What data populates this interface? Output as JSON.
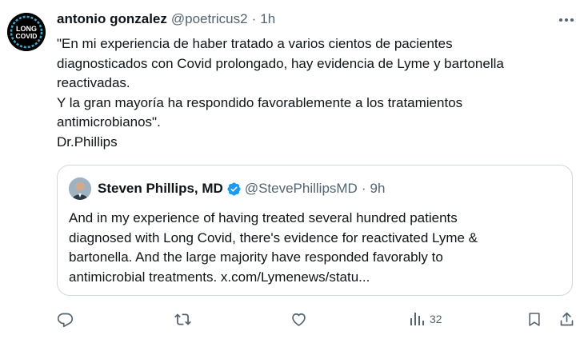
{
  "author": {
    "name": "antonio gonzalez",
    "handle": "@poetricus2",
    "separator": "·",
    "time": "1h",
    "avatar_text_top": "LONG COVID",
    "avatar_text_main_1": "LONG",
    "avatar_text_main_2": "COVID"
  },
  "tweet": {
    "lines": [
      "\"En mi experiencia de haber tratado a varios cientos de pacientes",
      "diagnosticados con Covid prolongado, hay evidencia de Lyme y bartonella",
      "reactivadas.",
      "Y la gran mayoría ha respondido favorablemente a los tratamientos",
      "antimicrobianos\".",
      "Dr.Phillips"
    ]
  },
  "quote": {
    "name": "Steven Phillips, MD",
    "handle": "@StevePhillipsMD",
    "separator": "·",
    "time": "9h",
    "lines": [
      "And in my experience of having treated several hundred patients",
      "diagnosed with Long Covid, there's evidence for reactivated Lyme &",
      "bartonella. And the large majority have responded favorably to",
      "antimicrobial treatments. x.com/Lymenews/statu..."
    ]
  },
  "actions": {
    "views_count": "32"
  },
  "colors": {
    "text": "#0f1419",
    "secondary": "#536471",
    "border": "#cfd9de",
    "verified": "#1d9bf0"
  }
}
